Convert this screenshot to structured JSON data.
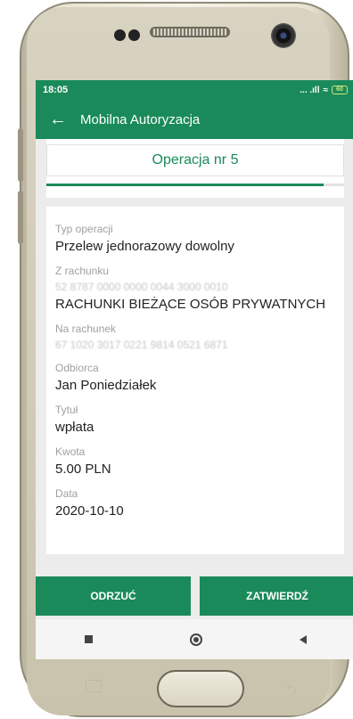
{
  "status": {
    "time": "18:05",
    "signal": "... .ıll",
    "wifi": "≈",
    "battery": "60"
  },
  "appbar": {
    "back_icon": "←",
    "title": "Mobilna Autoryzacja"
  },
  "operation": {
    "title": "Operacja nr 5",
    "progress_fraction": 0.93
  },
  "details": [
    {
      "label": "Typ operacji",
      "value": "Przelew jednorazowy dowolny"
    },
    {
      "label": "Z rachunku",
      "account": "52 8787 0000 0000 0044 3000 0010",
      "value": "RACHUNKI BIEŻĄCE OSÓB PRYWATNYCH"
    },
    {
      "label": "Na rachunek",
      "account": "67 1020 3017 0221 9814 0521 6871"
    },
    {
      "label": "Odbiorca",
      "value": "Jan Poniedziałek"
    },
    {
      "label": "Tytuł",
      "value": "wpłata"
    },
    {
      "label": "Kwota",
      "value": "5.00 PLN"
    },
    {
      "label": "Data",
      "value": "2020-10-10"
    }
  ],
  "actions": {
    "reject_label": "ODRZUĆ",
    "confirm_label": "ZATWIERDŹ"
  },
  "colors": {
    "brand": "#1a8a5a"
  }
}
